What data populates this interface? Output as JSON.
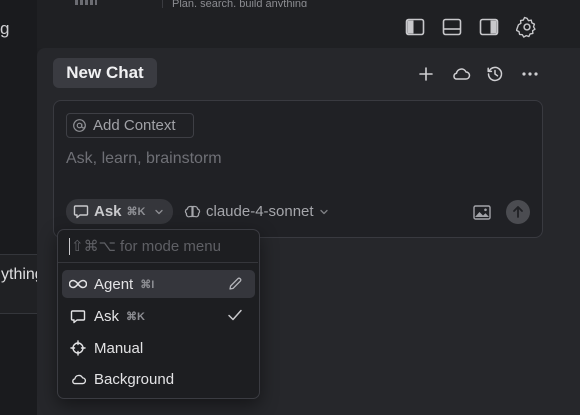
{
  "left_pane": {
    "title_fragment": "g",
    "popup_text": "ything"
  },
  "topbar": {
    "hint_text": "Plan, search, build anything",
    "icons": [
      "toggle-left-sidebar-icon",
      "toggle-bottom-panel-icon",
      "toggle-right-sidebar-icon",
      "gear-icon"
    ]
  },
  "chat_header": {
    "tab_label": "New Chat",
    "icons": [
      "plus-icon",
      "cloud-icon",
      "history-icon",
      "more-icon"
    ]
  },
  "composer": {
    "add_context_label": "Add Context",
    "placeholder": "Ask, learn, brainstorm",
    "mode": {
      "label": "Ask",
      "shortcut": "⌘K"
    },
    "model": "claude-4-sonnet"
  },
  "mode_menu": {
    "search_placeholder": "⇧⌘⌥ for mode menu",
    "items": [
      {
        "label": "Agent",
        "shortcut": "⌘I",
        "icon": "infinity-icon",
        "highlighted": true,
        "trail_icon": "pencil-icon"
      },
      {
        "label": "Ask",
        "shortcut": "⌘K",
        "icon": "chat-bubble-icon",
        "selected": true,
        "trail_icon": "checkmark-icon"
      },
      {
        "label": "Manual",
        "shortcut": "",
        "icon": "crosshair-icon"
      },
      {
        "label": "Background",
        "shortcut": "",
        "icon": "cloud-icon"
      }
    ]
  },
  "colors": {
    "background": "#1e1f22",
    "panel": "#26272b",
    "highlight": "#35363c",
    "text": "#e3e3e5"
  }
}
